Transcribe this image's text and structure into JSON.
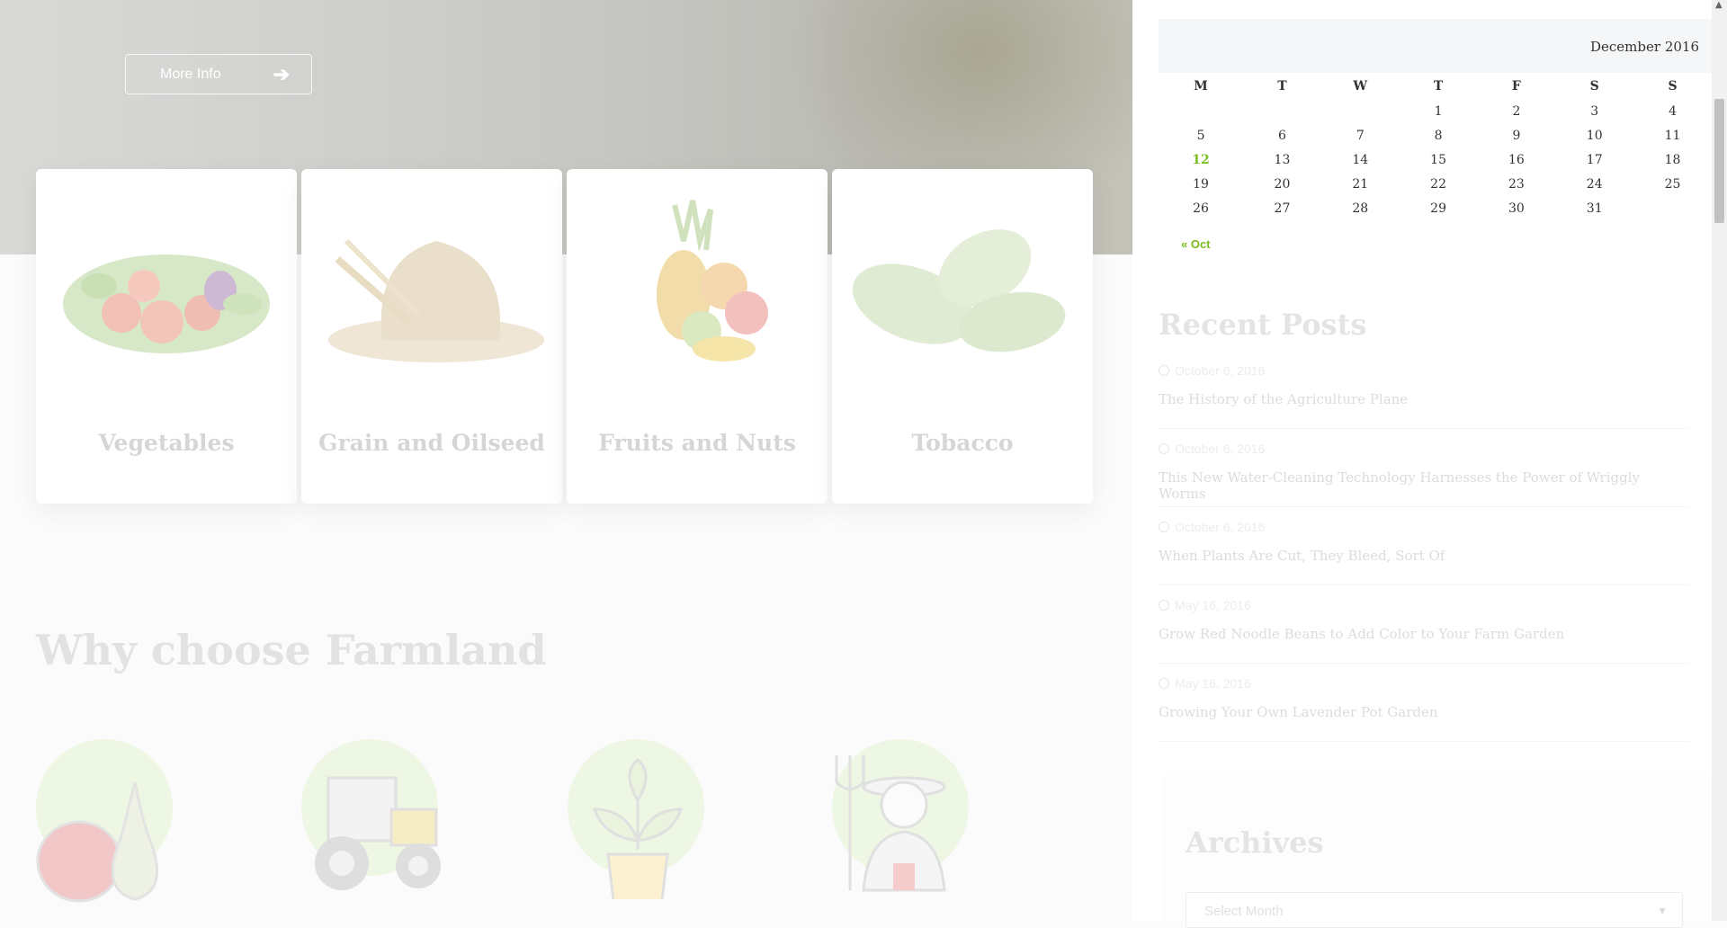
{
  "hero": {
    "more_info_label": "More Info"
  },
  "categories": [
    {
      "label": "Vegetables"
    },
    {
      "label": "Grain and Oilseed"
    },
    {
      "label": "Fruits and Nuts"
    },
    {
      "label": "Tobacco"
    }
  ],
  "why_title": "Why choose Farmland",
  "calendar": {
    "caption": "December 2016",
    "weekdays": [
      "M",
      "T",
      "W",
      "T",
      "F",
      "S",
      "S"
    ],
    "weeks": [
      [
        "",
        "",
        "",
        "1",
        "2",
        "3",
        "4"
      ],
      [
        "5",
        "6",
        "7",
        "8",
        "9",
        "10",
        "11"
      ],
      [
        "12",
        "13",
        "14",
        "15",
        "16",
        "17",
        "18"
      ],
      [
        "19",
        "20",
        "21",
        "22",
        "23",
        "24",
        "25"
      ],
      [
        "26",
        "27",
        "28",
        "29",
        "30",
        "31",
        ""
      ]
    ],
    "today": "12",
    "prev_label": "« Oct"
  },
  "recent_posts": {
    "title": "Recent Posts",
    "items": [
      {
        "date": "October 6, 2016",
        "title": "The History of the Agriculture Plane"
      },
      {
        "date": "October 6, 2016",
        "title": "This New Water-Cleaning Technology Harnesses the Power of Wriggly Worms"
      },
      {
        "date": "October 6, 2016",
        "title": "When Plants Are Cut, They Bleed, Sort Of"
      },
      {
        "date": "May 16, 2016",
        "title": "Grow Red Noodle Beans to Add Color to Your Farm Garden"
      },
      {
        "date": "May 16, 2016",
        "title": "Growing Your Own Lavender Pot Garden"
      }
    ]
  },
  "archives": {
    "title": "Archives",
    "select_placeholder": "Select Month"
  },
  "colors": {
    "accent": "#7bbd1f",
    "circle": "#eef7e3"
  }
}
